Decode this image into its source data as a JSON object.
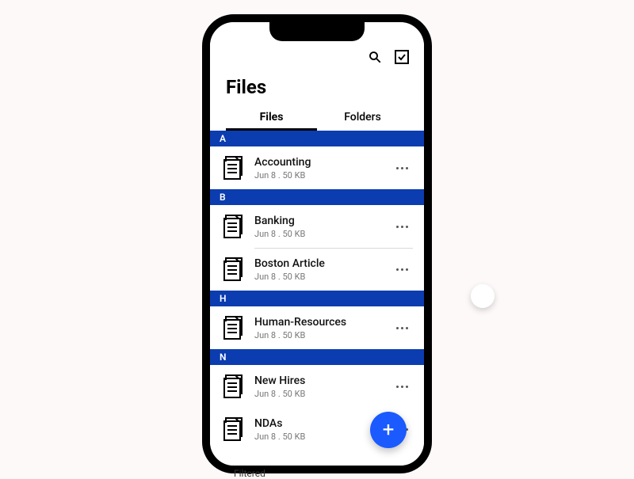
{
  "header": {
    "title": "Files"
  },
  "tabs": {
    "files": "Files",
    "folders": "Folders"
  },
  "sections": {
    "a": "A",
    "b": "B",
    "h": "H",
    "n": "N"
  },
  "files": {
    "accounting": {
      "name": "Accounting",
      "meta": "Jun 8 . 50 KB"
    },
    "banking": {
      "name": "Banking",
      "meta": "Jun 8 . 50 KB"
    },
    "boston": {
      "name": "Boston Article",
      "meta": "Jun 8 . 50 KB"
    },
    "hr": {
      "name": "Human-Resources",
      "meta": "Jun 8 . 50 KB"
    },
    "newhires": {
      "name": "New Hires",
      "meta": "Jun 8 . 50 KB"
    },
    "ndas": {
      "name": "NDAs",
      "meta": "Jun 8 . 50 KB"
    }
  },
  "fab": {
    "label": "+"
  },
  "below": {
    "text": "Filtered"
  }
}
